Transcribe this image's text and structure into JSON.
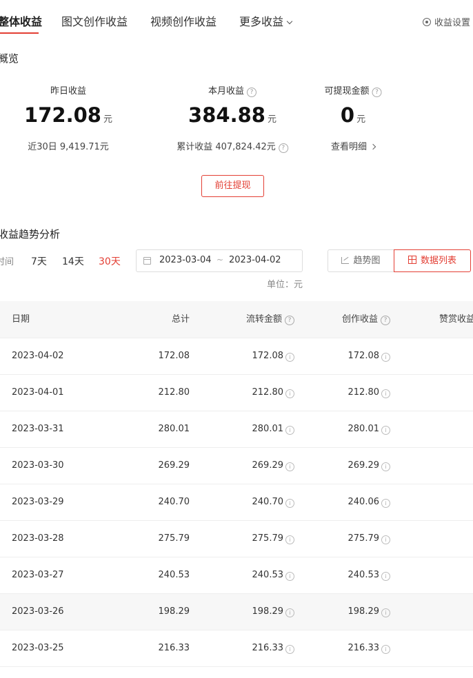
{
  "tabs": [
    {
      "label": "整体收益",
      "active": true
    },
    {
      "label": "图文创作收益",
      "active": false
    },
    {
      "label": "视频创作收益",
      "active": false
    },
    {
      "label": "更多收益",
      "active": false
    }
  ],
  "settings_label": "收益设置",
  "overview": {
    "title": "概览",
    "stats": [
      {
        "label": "昨日收益",
        "value": "172.08",
        "unit": "元",
        "sub": "近30日 9,419.71元"
      },
      {
        "label": "本月收益",
        "value": "384.88",
        "unit": "元",
        "sub": "累计收益 407,824.42元"
      },
      {
        "label": "可提现金额",
        "value": "0",
        "unit": "元",
        "sub": "查看明细"
      }
    ],
    "withdraw_button": "前往提现"
  },
  "trend": {
    "title": "收益趋势分析",
    "time_prefix": "时间",
    "ranges": [
      "7天",
      "14天",
      "30天"
    ],
    "active_range": "30天",
    "date_start": "2023-03-04",
    "date_sep": "~",
    "date_end": "2023-04-02",
    "view_buttons": [
      "趋势图",
      "数据列表"
    ],
    "active_view": "数据列表",
    "unit_note": "单位：元"
  },
  "table": {
    "headers": [
      "日期",
      "总计",
      "流转金额",
      "创作收益",
      "赞赏收益"
    ],
    "rows": [
      {
        "date": "2023-04-02",
        "total": "172.08",
        "flow": "172.08",
        "create": "172.08"
      },
      {
        "date": "2023-04-01",
        "total": "212.80",
        "flow": "212.80",
        "create": "212.80"
      },
      {
        "date": "2023-03-31",
        "total": "280.01",
        "flow": "280.01",
        "create": "280.01"
      },
      {
        "date": "2023-03-30",
        "total": "269.29",
        "flow": "269.29",
        "create": "269.29"
      },
      {
        "date": "2023-03-29",
        "total": "240.70",
        "flow": "240.70",
        "create": "240.06"
      },
      {
        "date": "2023-03-28",
        "total": "275.79",
        "flow": "275.79",
        "create": "275.79"
      },
      {
        "date": "2023-03-27",
        "total": "240.53",
        "flow": "240.53",
        "create": "240.53"
      },
      {
        "date": "2023-03-26",
        "total": "198.29",
        "flow": "198.29",
        "create": "198.29"
      },
      {
        "date": "2023-03-25",
        "total": "216.33",
        "flow": "216.33",
        "create": "216.33"
      }
    ]
  },
  "colors": {
    "accent": "#e33e33",
    "header_bg": "#f7f7f7",
    "border": "#eeeeee"
  },
  "icons": {
    "settings": "gear-icon",
    "more": "chevron-down-icon",
    "help": "question-circle-icon",
    "info": "info-circle-icon",
    "calendar": "calendar-icon",
    "trend": "line-chart-icon",
    "list": "table-icon",
    "link": "chevron-right-icon"
  }
}
